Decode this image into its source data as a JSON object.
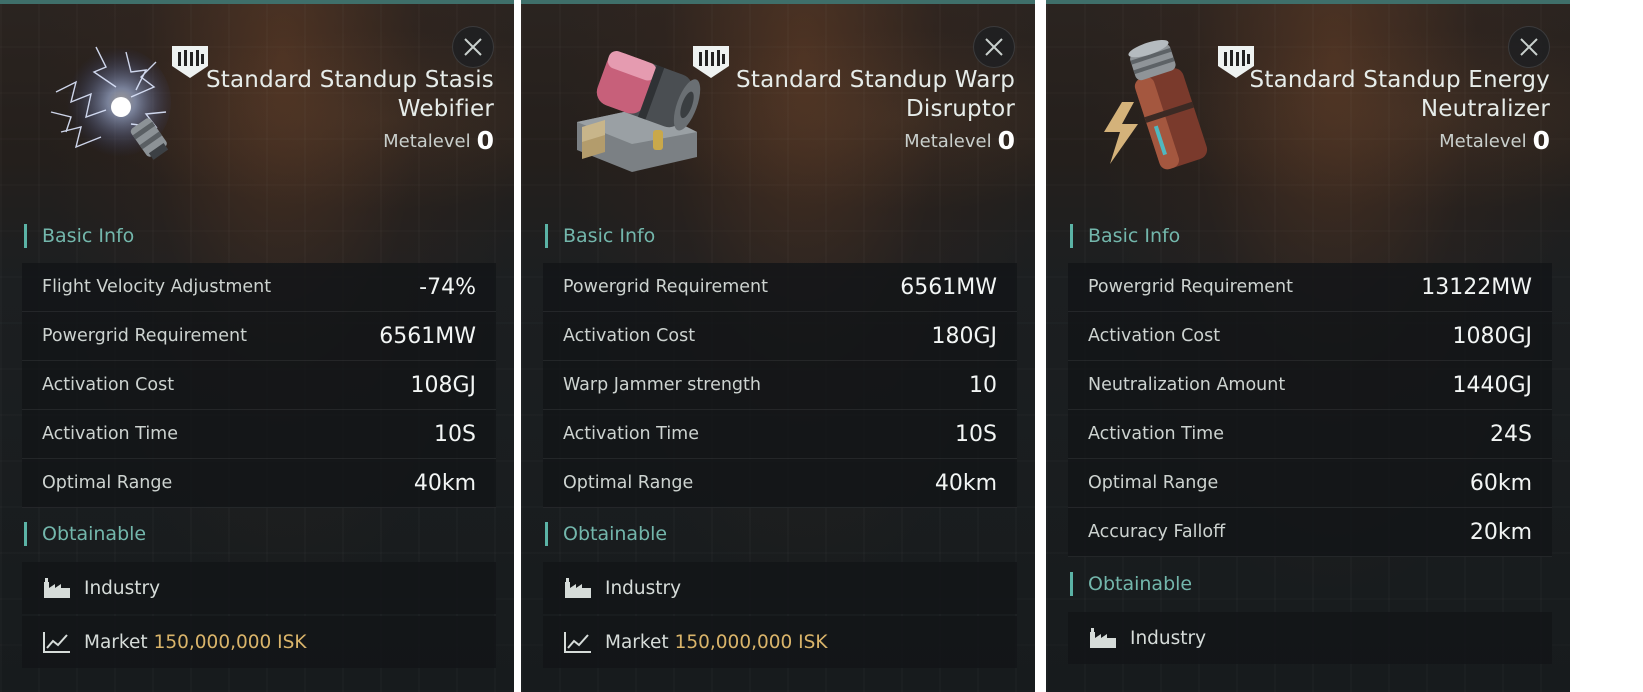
{
  "panels": [
    {
      "title": "Standard Standup Stasis Webifier",
      "title_line1": "Standard Standup Stasis",
      "title_line2": "Webifier",
      "metalevel_label": "Metalevel",
      "metalevel_value": "0",
      "icon": "stasis-webifier-icon",
      "basic_info_label": "Basic Info",
      "stats": [
        {
          "label": "Flight Velocity Adjustment",
          "value": "-74%"
        },
        {
          "label": "Powergrid Requirement",
          "value": "6561MW"
        },
        {
          "label": "Activation Cost",
          "value": "108GJ"
        },
        {
          "label": "Activation Time",
          "value": "10S"
        },
        {
          "label": "Optimal Range",
          "value": "40km"
        }
      ],
      "obtainable_label": "Obtainable",
      "sources": [
        {
          "label": "Industry",
          "icon": "factory-icon"
        },
        {
          "label": "Market",
          "price": "150,000,000 ISK",
          "icon": "market-chart-icon"
        }
      ]
    },
    {
      "title": "Standard Standup Warp Disruptor",
      "title_line1": "Standard Standup Warp",
      "title_line2": "Disruptor",
      "metalevel_label": "Metalevel",
      "metalevel_value": "0",
      "icon": "warp-disruptor-icon",
      "basic_info_label": "Basic Info",
      "stats": [
        {
          "label": "Powergrid Requirement",
          "value": "6561MW"
        },
        {
          "label": "Activation Cost",
          "value": "180GJ"
        },
        {
          "label": "Warp Jammer strength",
          "value": "10"
        },
        {
          "label": "Activation Time",
          "value": "10S"
        },
        {
          "label": "Optimal Range",
          "value": "40km"
        }
      ],
      "obtainable_label": "Obtainable",
      "sources": [
        {
          "label": "Industry",
          "icon": "factory-icon"
        },
        {
          "label": "Market",
          "price": "150,000,000 ISK",
          "icon": "market-chart-icon"
        }
      ]
    },
    {
      "title": "Standard Standup Energy Neutralizer",
      "title_line1": "Standard Standup Energy",
      "title_line2": "Neutralizer",
      "metalevel_label": "Metalevel",
      "metalevel_value": "0",
      "icon": "energy-neutralizer-icon",
      "basic_info_label": "Basic Info",
      "stats": [
        {
          "label": "Powergrid Requirement",
          "value": "13122MW"
        },
        {
          "label": "Activation Cost",
          "value": "1080GJ"
        },
        {
          "label": "Neutralization Amount",
          "value": "1440GJ"
        },
        {
          "label": "Activation Time",
          "value": "24S"
        },
        {
          "label": "Optimal Range",
          "value": "60km"
        },
        {
          "label": "Accuracy Falloff",
          "value": "20km"
        }
      ],
      "obtainable_label": "Obtainable",
      "sources": [
        {
          "label": "Industry",
          "icon": "factory-icon"
        }
      ]
    }
  ],
  "colors": {
    "accent": "#5bb3a6",
    "section_text": "#73b7ac",
    "price": "#d9b46a",
    "row_bg": "#121517"
  }
}
